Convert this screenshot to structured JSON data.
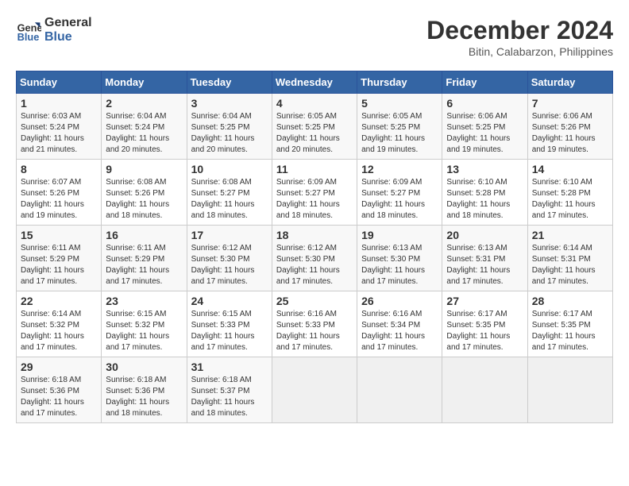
{
  "header": {
    "logo_line1": "General",
    "logo_line2": "Blue",
    "month_title": "December 2024",
    "subtitle": "Bitin, Calabarzon, Philippines"
  },
  "weekdays": [
    "Sunday",
    "Monday",
    "Tuesday",
    "Wednesday",
    "Thursday",
    "Friday",
    "Saturday"
  ],
  "weeks": [
    [
      {
        "day": "1",
        "info": "Sunrise: 6:03 AM\nSunset: 5:24 PM\nDaylight: 11 hours\nand 21 minutes."
      },
      {
        "day": "2",
        "info": "Sunrise: 6:04 AM\nSunset: 5:24 PM\nDaylight: 11 hours\nand 20 minutes."
      },
      {
        "day": "3",
        "info": "Sunrise: 6:04 AM\nSunset: 5:25 PM\nDaylight: 11 hours\nand 20 minutes."
      },
      {
        "day": "4",
        "info": "Sunrise: 6:05 AM\nSunset: 5:25 PM\nDaylight: 11 hours\nand 20 minutes."
      },
      {
        "day": "5",
        "info": "Sunrise: 6:05 AM\nSunset: 5:25 PM\nDaylight: 11 hours\nand 19 minutes."
      },
      {
        "day": "6",
        "info": "Sunrise: 6:06 AM\nSunset: 5:25 PM\nDaylight: 11 hours\nand 19 minutes."
      },
      {
        "day": "7",
        "info": "Sunrise: 6:06 AM\nSunset: 5:26 PM\nDaylight: 11 hours\nand 19 minutes."
      }
    ],
    [
      {
        "day": "8",
        "info": "Sunrise: 6:07 AM\nSunset: 5:26 PM\nDaylight: 11 hours\nand 19 minutes."
      },
      {
        "day": "9",
        "info": "Sunrise: 6:08 AM\nSunset: 5:26 PM\nDaylight: 11 hours\nand 18 minutes."
      },
      {
        "day": "10",
        "info": "Sunrise: 6:08 AM\nSunset: 5:27 PM\nDaylight: 11 hours\nand 18 minutes."
      },
      {
        "day": "11",
        "info": "Sunrise: 6:09 AM\nSunset: 5:27 PM\nDaylight: 11 hours\nand 18 minutes."
      },
      {
        "day": "12",
        "info": "Sunrise: 6:09 AM\nSunset: 5:27 PM\nDaylight: 11 hours\nand 18 minutes."
      },
      {
        "day": "13",
        "info": "Sunrise: 6:10 AM\nSunset: 5:28 PM\nDaylight: 11 hours\nand 18 minutes."
      },
      {
        "day": "14",
        "info": "Sunrise: 6:10 AM\nSunset: 5:28 PM\nDaylight: 11 hours\nand 17 minutes."
      }
    ],
    [
      {
        "day": "15",
        "info": "Sunrise: 6:11 AM\nSunset: 5:29 PM\nDaylight: 11 hours\nand 17 minutes."
      },
      {
        "day": "16",
        "info": "Sunrise: 6:11 AM\nSunset: 5:29 PM\nDaylight: 11 hours\nand 17 minutes."
      },
      {
        "day": "17",
        "info": "Sunrise: 6:12 AM\nSunset: 5:30 PM\nDaylight: 11 hours\nand 17 minutes."
      },
      {
        "day": "18",
        "info": "Sunrise: 6:12 AM\nSunset: 5:30 PM\nDaylight: 11 hours\nand 17 minutes."
      },
      {
        "day": "19",
        "info": "Sunrise: 6:13 AM\nSunset: 5:30 PM\nDaylight: 11 hours\nand 17 minutes."
      },
      {
        "day": "20",
        "info": "Sunrise: 6:13 AM\nSunset: 5:31 PM\nDaylight: 11 hours\nand 17 minutes."
      },
      {
        "day": "21",
        "info": "Sunrise: 6:14 AM\nSunset: 5:31 PM\nDaylight: 11 hours\nand 17 minutes."
      }
    ],
    [
      {
        "day": "22",
        "info": "Sunrise: 6:14 AM\nSunset: 5:32 PM\nDaylight: 11 hours\nand 17 minutes."
      },
      {
        "day": "23",
        "info": "Sunrise: 6:15 AM\nSunset: 5:32 PM\nDaylight: 11 hours\nand 17 minutes."
      },
      {
        "day": "24",
        "info": "Sunrise: 6:15 AM\nSunset: 5:33 PM\nDaylight: 11 hours\nand 17 minutes."
      },
      {
        "day": "25",
        "info": "Sunrise: 6:16 AM\nSunset: 5:33 PM\nDaylight: 11 hours\nand 17 minutes."
      },
      {
        "day": "26",
        "info": "Sunrise: 6:16 AM\nSunset: 5:34 PM\nDaylight: 11 hours\nand 17 minutes."
      },
      {
        "day": "27",
        "info": "Sunrise: 6:17 AM\nSunset: 5:35 PM\nDaylight: 11 hours\nand 17 minutes."
      },
      {
        "day": "28",
        "info": "Sunrise: 6:17 AM\nSunset: 5:35 PM\nDaylight: 11 hours\nand 17 minutes."
      }
    ],
    [
      {
        "day": "29",
        "info": "Sunrise: 6:18 AM\nSunset: 5:36 PM\nDaylight: 11 hours\nand 17 minutes."
      },
      {
        "day": "30",
        "info": "Sunrise: 6:18 AM\nSunset: 5:36 PM\nDaylight: 11 hours\nand 18 minutes."
      },
      {
        "day": "31",
        "info": "Sunrise: 6:18 AM\nSunset: 5:37 PM\nDaylight: 11 hours\nand 18 minutes."
      },
      {
        "day": "",
        "info": ""
      },
      {
        "day": "",
        "info": ""
      },
      {
        "day": "",
        "info": ""
      },
      {
        "day": "",
        "info": ""
      }
    ]
  ]
}
